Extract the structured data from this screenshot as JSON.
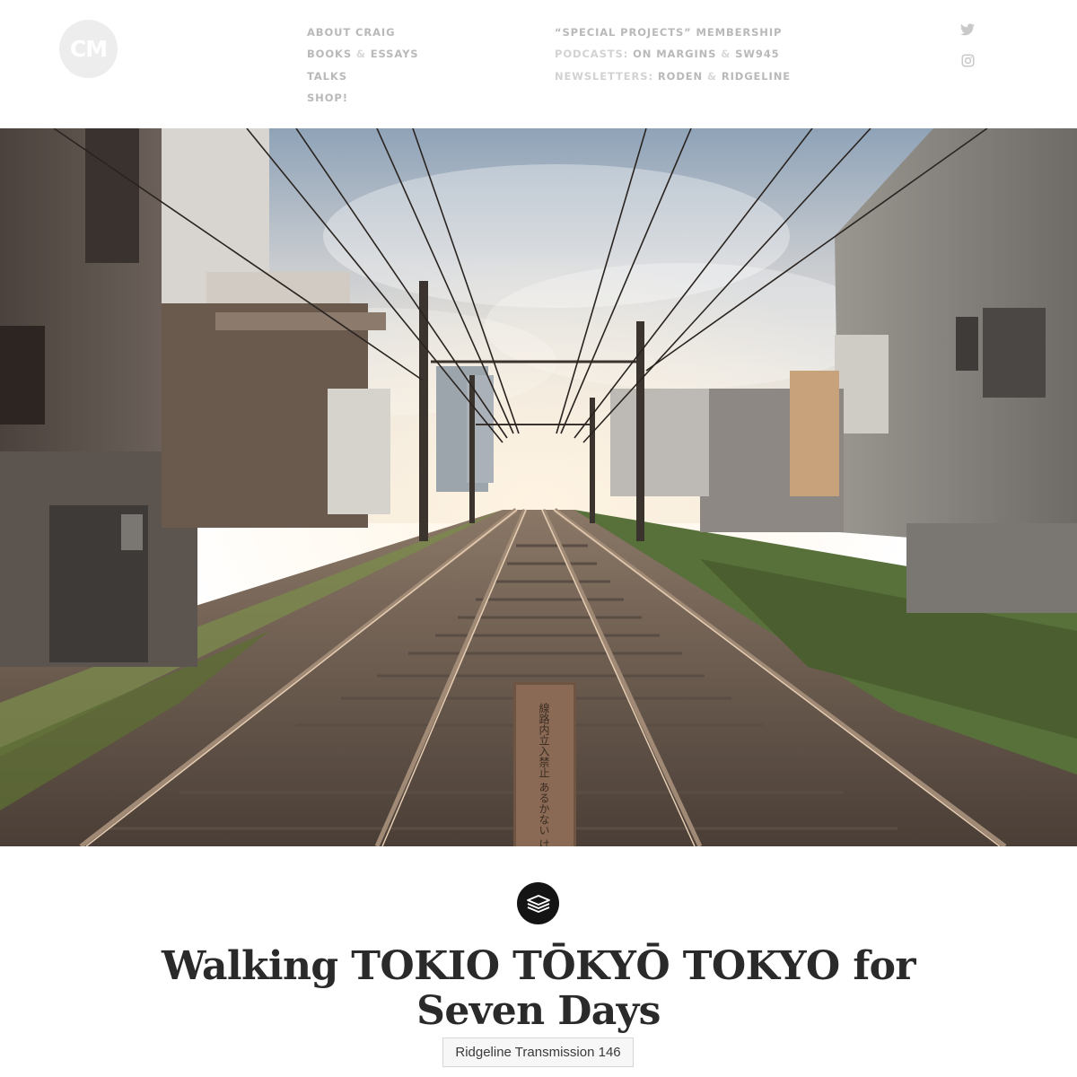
{
  "header": {
    "logo_text": "CM",
    "nav_left": [
      {
        "label": "ABOUT CRAIG"
      },
      {
        "first": "BOOKS",
        "sep": "&",
        "second": "ESSAYS"
      },
      {
        "label": "TALKS"
      },
      {
        "label": "SHOP!"
      }
    ],
    "nav_right": {
      "membership": "“SPECIAL PROJECTS” MEMBERSHIP",
      "podcasts": {
        "prefix": "PODCASTS:",
        "first": "ON MARGINS",
        "sep": "&",
        "second": "SW945"
      },
      "newsletters": {
        "prefix": "NEWSLETTERS:",
        "first": "RODEN",
        "sep": "&",
        "second": "RIDGELINE"
      }
    },
    "social_icons": [
      "twitter-icon",
      "instagram-icon"
    ]
  },
  "hero": {
    "sign_text": "線路内立入禁止 あるかない けんろは…"
  },
  "article": {
    "badge_icon": "stack-icon",
    "title": "Walking TOKIO TŌKYŌ TOKYO for Seven Days",
    "tag": "Ridgeline Transmission 146"
  },
  "colors": {
    "nav_text": "#b9b9b9",
    "logo_bg": "#ededed",
    "badge_bg": "#141414",
    "title_text": "#2a2a2a"
  }
}
